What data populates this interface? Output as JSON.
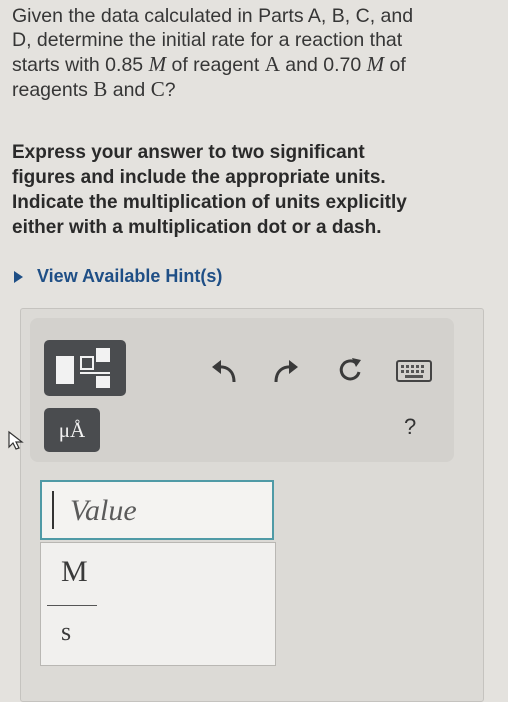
{
  "question": {
    "line1": "Given the data calculated in Parts A, B, C, and",
    "line2": "D, determine the initial rate for a reaction that",
    "line3a": "starts with 0.85 ",
    "unit_M": "M",
    "line3b": " of reagent ",
    "reagent_A": "A",
    "line3c": " and 0.70 ",
    "line3d": " of",
    "line4a": "reagents ",
    "reagent_B": "B",
    "line4b": " and ",
    "reagent_C": "C",
    "line4c": "?"
  },
  "instruction": {
    "line1": "Express your answer to two significant",
    "line2": "figures and include the appropriate units.",
    "line3": "Indicate the multiplication of units explicitly",
    "line4": "either with a multiplication dot or a dash."
  },
  "hint": {
    "label": "View Available Hint(s)"
  },
  "toolbar": {
    "units_label": "μÅ",
    "help_label": "?"
  },
  "answer": {
    "value_placeholder": "Value",
    "unit_numerator": "M",
    "unit_denominator": "s"
  },
  "colors": {
    "background": "#e4e2de",
    "hint_link": "#1f4f86",
    "active_border": "#4f9aa6",
    "button_dark": "#4a4c4f"
  }
}
